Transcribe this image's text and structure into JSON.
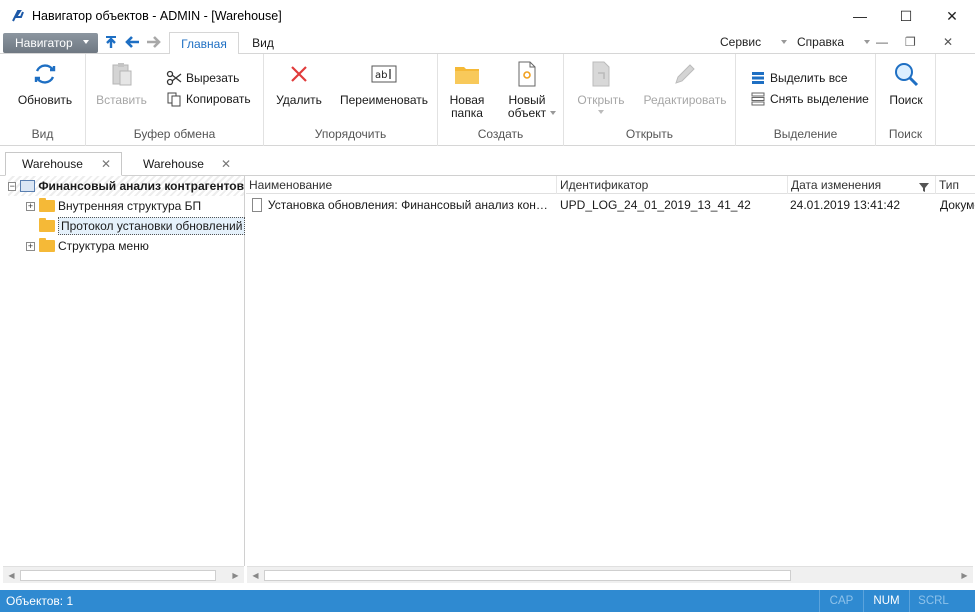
{
  "window": {
    "title": "Навигатор объектов - ADMIN - [Warehouse]",
    "controls": {
      "minimize": "—",
      "maximize": "☐",
      "close": "✕"
    }
  },
  "menubar": {
    "navigator_label": "Навигатор",
    "tabs": [
      {
        "label": "Главная",
        "active": true
      },
      {
        "label": "Вид",
        "active": false
      }
    ],
    "right_menus": [
      {
        "label": "Сервис"
      },
      {
        "label": "Справка"
      }
    ],
    "mdi_controls": {
      "minimize": "—",
      "restore": "❐",
      "close": "✕"
    }
  },
  "ribbon": {
    "groups": {
      "view": {
        "label": "Вид",
        "refresh": "Обновить"
      },
      "clipboard": {
        "label": "Буфер обмена",
        "paste": "Вставить",
        "cut": "Вырезать",
        "copy": "Копировать"
      },
      "organize": {
        "label": "Упорядочить",
        "delete": "Удалить",
        "rename": "Переименовать"
      },
      "create": {
        "label": "Создать",
        "new_folder_line1": "Новая",
        "new_folder_line2": "папка",
        "new_object_line1": "Новый",
        "new_object_line2": "объект"
      },
      "open": {
        "label": "Открыть",
        "open": "Открыть",
        "edit": "Редактировать"
      },
      "selection": {
        "label": "Выделение",
        "select_all": "Выделить все",
        "deselect": "Снять выделение"
      },
      "search": {
        "label": "Поиск",
        "search": "Поиск"
      }
    }
  },
  "doc_tabs": [
    {
      "label": "Warehouse",
      "active": true
    },
    {
      "label": "Warehouse",
      "active": false
    }
  ],
  "tree": {
    "root": "Финансовый анализ контрагентов",
    "children": [
      {
        "label": "Внутренняя структура БП",
        "expandable": true
      },
      {
        "label": "Протокол установки обновлений",
        "expandable": false,
        "selected": true
      },
      {
        "label": "Структура меню",
        "expandable": true
      }
    ]
  },
  "table": {
    "columns": [
      "Наименование",
      "Идентификатор",
      "Дата изменения",
      "Тип"
    ],
    "rows": [
      {
        "name": "Установка обновления: Финансовый анализ контрагентов",
        "id": "UPD_LOG_24_01_2019_13_41_42",
        "date": "24.01.2019 13:41:42",
        "type": "Документ"
      }
    ]
  },
  "status": {
    "objects": "Объектов: 1",
    "cap": "CAP",
    "num": "NUM",
    "scrl": "SCRL"
  },
  "colors": {
    "accent": "#1e6fc3",
    "statusbar": "#2f8ad1",
    "folder": "#f5b937",
    "delete": "#e03c3c"
  }
}
